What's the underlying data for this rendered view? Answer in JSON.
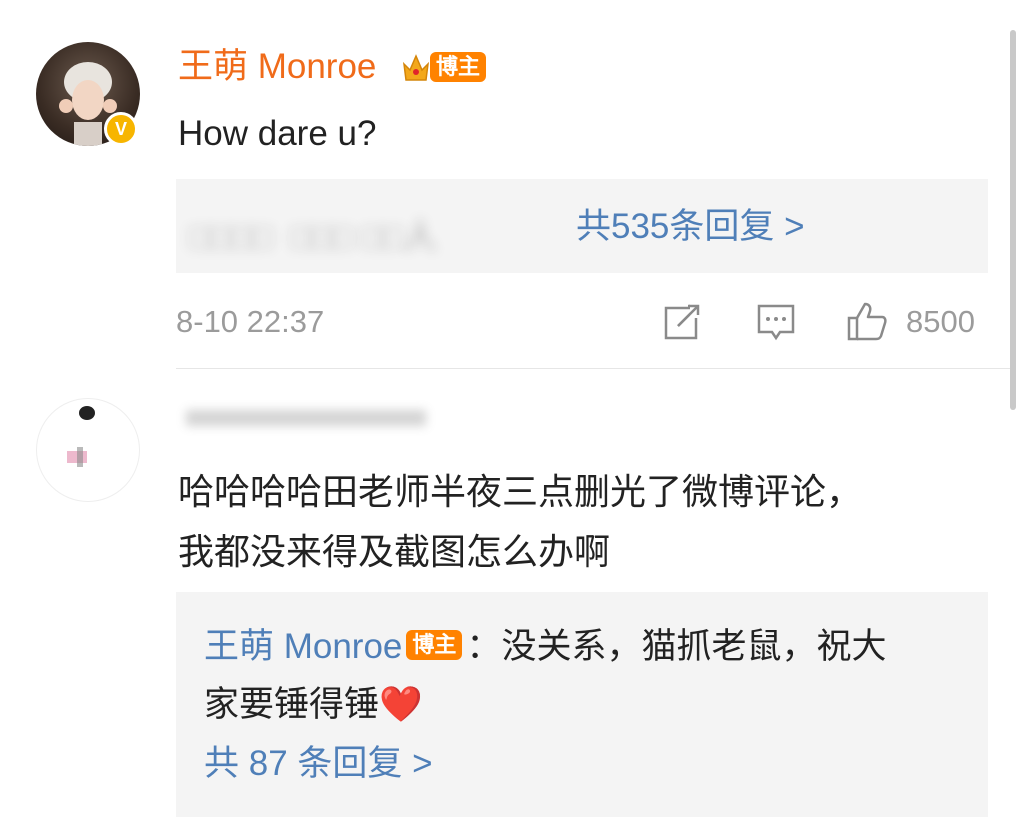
{
  "comments": [
    {
      "author": "王萌 Monroe",
      "author_badge": "博主",
      "text": "How dare u?",
      "replies_preview": "人",
      "reply_count_label": "共535条回复 >",
      "timestamp": "8-10 22:37",
      "likes": "8500"
    },
    {
      "text_line1": "哈哈哈哈田老师半夜三点删光了微博评论，",
      "text_line2": "我都没来得及截图怎么办啊",
      "reply": {
        "author": "王萌 Monroe",
        "author_badge": "博主",
        "separator": "：",
        "text_line1": "没关系，猫抓老鼠，祝大",
        "text_line2": "家要锤得锤",
        "emoji": "❤️"
      },
      "reply_count_label": "共 87 条回复 >"
    }
  ],
  "icons": {
    "share": "share-icon",
    "comment": "comment-icon",
    "like": "thumbs-up-icon",
    "verified": "verified-v-icon",
    "crown": "crown-icon"
  },
  "colors": {
    "author_orange": "#f06b1a",
    "badge_orange": "#ff8200",
    "link_blue": "#4f7fb8",
    "meta_gray": "#9b9b9b",
    "box_bg": "#f4f4f4"
  }
}
